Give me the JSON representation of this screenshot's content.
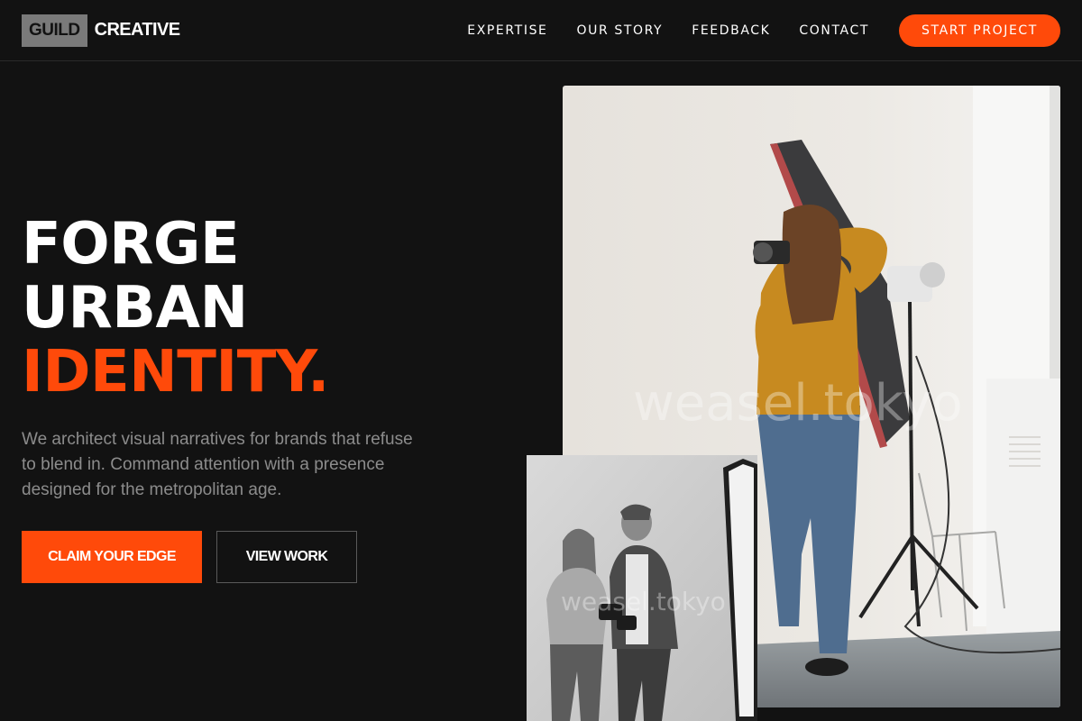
{
  "brand": {
    "box_text": "GUILD",
    "name": "CREATIVE"
  },
  "nav": {
    "links": [
      "EXPERTISE",
      "OUR STORY",
      "FEEDBACK",
      "CONTACT"
    ],
    "cta": "START PROJECT"
  },
  "hero": {
    "title_lines": [
      "FORGE",
      "URBAN",
      "IDENTITY."
    ],
    "description": "We architect visual narratives for brands that refuse to blend in. Command attention with a presence designed for the metropolitan age.",
    "primary_button": "CLAIM YOUR EDGE",
    "secondary_button": "VIEW WORK"
  },
  "images": {
    "main_alt": "Photographer shooting in a bright studio with softbox lighting",
    "secondary_alt": "Black and white photo of two people reviewing a camera",
    "watermark": "weasel.tokyo"
  },
  "colors": {
    "accent": "#ff4a0a",
    "background": "#121212",
    "muted_text": "#8c8c8c"
  }
}
